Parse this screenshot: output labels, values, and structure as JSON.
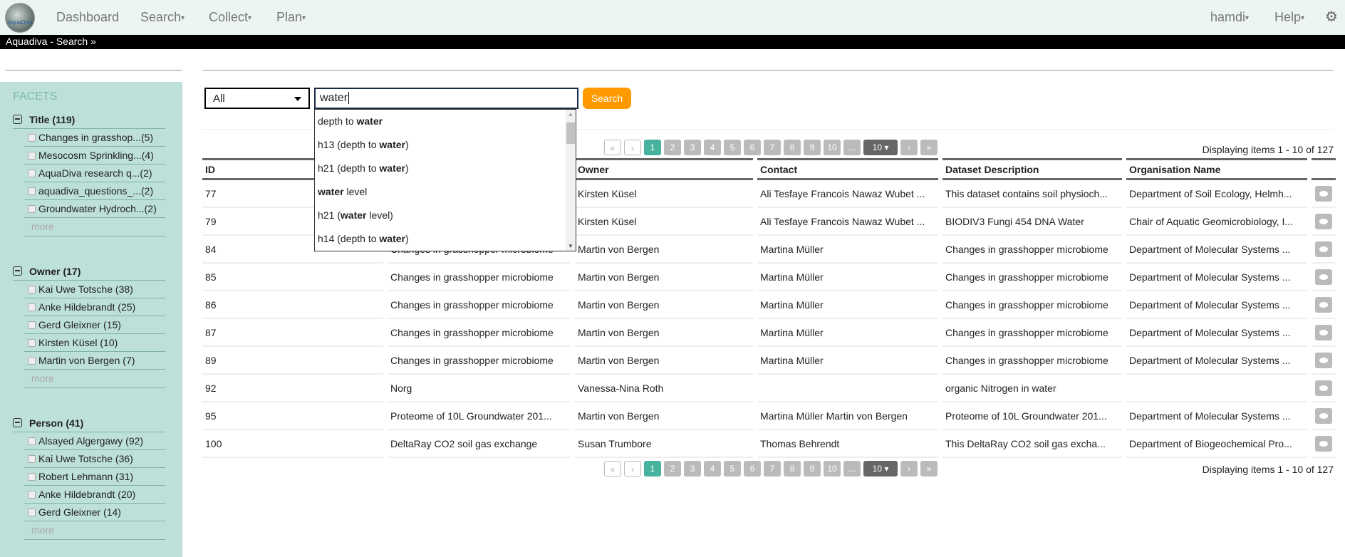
{
  "nav": {
    "logo_text": "AquaDiva",
    "items": [
      "Dashboard",
      "Search",
      "Collect",
      "Plan"
    ],
    "user": "hamdi",
    "help": "Help"
  },
  "breadcrumb": "Aquadiva - Search »",
  "facets": {
    "title": "FACETS",
    "more": "more",
    "groups": [
      {
        "label": "Title (119)",
        "items": [
          "Changes in grasshop...(5)",
          "Mesocosm Sprinkling...(4)",
          "AquaDiva research q...(2)",
          "aquadiva_questions_...(2)",
          "Groundwater Hydroch...(2)"
        ]
      },
      {
        "label": "Owner (17)",
        "items": [
          "Kai Uwe Totsche (38)",
          "Anke Hildebrandt (25)",
          "Gerd Gleixner (15)",
          "Kirsten Küsel (10)",
          "Martin von Bergen (7)"
        ]
      },
      {
        "label": "Person (41)",
        "items": [
          "Alsayed Algergawy (92)",
          "Kai Uwe Totsche (36)",
          "Robert Lehmann (31)",
          "Anke Hildebrandt (20)",
          "Gerd Gleixner (14)"
        ]
      }
    ]
  },
  "search": {
    "scope": "All",
    "query": "water",
    "button": "Search",
    "suggestions": [
      [
        "depth to ",
        "water",
        ""
      ],
      [
        "h13 (depth to ",
        "water",
        ")"
      ],
      [
        "h21 (depth to ",
        "water",
        ")"
      ],
      [
        "",
        "water",
        " level"
      ],
      [
        "h21 (",
        "water",
        " level)"
      ],
      [
        "h14 (depth to ",
        "water",
        ")"
      ]
    ]
  },
  "pager": {
    "pages": [
      "1",
      "2",
      "3",
      "4",
      "5",
      "6",
      "7",
      "8",
      "9",
      "10",
      "..."
    ],
    "page_size": "10",
    "display": "Displaying items 1 - 10 of 127",
    "current_page": 1
  },
  "table": {
    "headers": [
      "ID",
      "",
      "Owner",
      "Contact",
      "Dataset Description",
      "Organisation Name"
    ],
    "rows": [
      [
        "77",
        "",
        "Kirsten Küsel",
        "Ali Tesfaye Francois Nawaz Wubet ...",
        "This dataset contains soil physioch...",
        "Department of Soil Ecology, Helmh..."
      ],
      [
        "79",
        "",
        "Kirsten Küsel",
        "Ali Tesfaye Francois Nawaz Wubet ...",
        "BIODIV3 Fungi 454 DNA Water",
        "Chair of Aquatic Geomicrobiology, I..."
      ],
      [
        "84",
        "Changes in grasshopper microbiome",
        "Martin von Bergen",
        "Martina Müller",
        "Changes in grasshopper microbiome",
        "Department of Molecular Systems ..."
      ],
      [
        "85",
        "Changes in grasshopper microbiome",
        "Martin von Bergen",
        "Martina Müller",
        "Changes in grasshopper microbiome",
        "Department of Molecular Systems ..."
      ],
      [
        "86",
        "Changes in grasshopper microbiome",
        "Martin von Bergen",
        "Martina Müller",
        "Changes in grasshopper microbiome",
        "Department of Molecular Systems ..."
      ],
      [
        "87",
        "Changes in grasshopper microbiome",
        "Martin von Bergen",
        "Martina Müller",
        "Changes in grasshopper microbiome",
        "Department of Molecular Systems ..."
      ],
      [
        "89",
        "Changes in grasshopper microbiome",
        "Martin von Bergen",
        "Martina Müller",
        "Changes in grasshopper microbiome",
        "Department of Molecular Systems ..."
      ],
      [
        "92",
        "Norg",
        "Vanessa-Nina Roth",
        "",
        "organic Nitrogen in water",
        ""
      ],
      [
        "95",
        "Proteome of 10L Groundwater 201...",
        "Martin von Bergen",
        "Martina Müller Martin von Bergen",
        "Proteome of 10L Groundwater 201...",
        "Department of Molecular Systems ..."
      ],
      [
        "100",
        "DeltaRay CO2 soil gas exchange",
        "Susan Trumbore",
        "Thomas Behrendt",
        "This DeltaRay CO2 soil gas excha...",
        "Department of Biogeochemical Pro..."
      ]
    ]
  }
}
